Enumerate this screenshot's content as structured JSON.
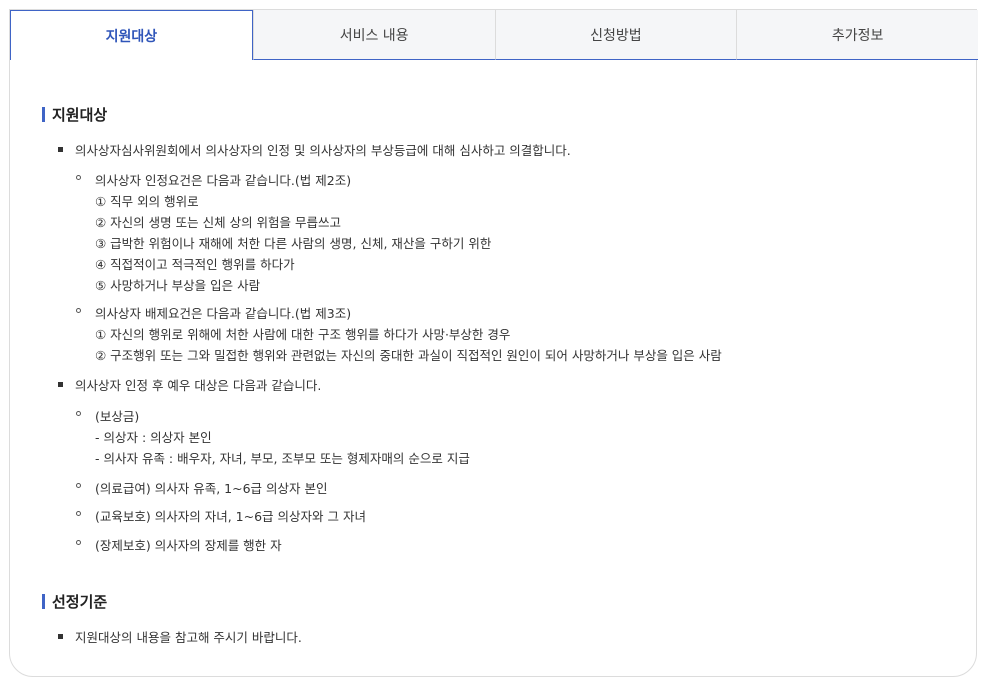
{
  "tabs": [
    {
      "label": "지원대상"
    },
    {
      "label": "서비스 내용"
    },
    {
      "label": "신청방법"
    },
    {
      "label": "추가정보"
    }
  ],
  "sections": {
    "target": {
      "title": "지원대상",
      "item1": "의사상자심사위원회에서 의사상자의 인정 및 의사상자의 부상등급에 대해 심사하고 의결합니다.",
      "sub1": {
        "lines": [
          "의사상자 인정요건은 다음과 같습니다.(법 제2조)",
          "① 직무 외의 행위로",
          "② 자신의 생명 또는 신체 상의 위험을 무릅쓰고",
          "③ 급박한 위험이나 재해에 처한 다른 사람의 생명, 신체, 재산을 구하기 위한",
          "④ 직접적이고 적극적인 행위를 하다가",
          "⑤ 사망하거나 부상을 입은 사람"
        ]
      },
      "sub2": {
        "lines": [
          "의사상자 배제요건은 다음과 같습니다.(법 제3조)",
          "① 자신의 행위로 위해에 처한 사람에 대한 구조 행위를 하다가 사망·부상한 경우",
          "② 구조행위 또는 그와 밀접한 행위와 관련없는 자신의 중대한 과실이 직접적인 원인이 되어 사망하거나 부상을 입은 사람"
        ]
      },
      "item2": "의사상자 인정 후 예우 대상은 다음과 같습니다.",
      "sub3": {
        "lines": [
          "(보상금)",
          "- 의상자 : 의상자 본인",
          "- 의사자 유족 : 배우자, 자녀, 부모, 조부모 또는 형제자매의 순으로 지급"
        ]
      },
      "sub4": "(의료급여) 의사자 유족, 1~6급 의상자 본인",
      "sub5": "(교육보호) 의사자의 자녀, 1~6급 의상자와 그 자녀",
      "sub6": "(장제보호) 의사자의 장제를 행한 자"
    },
    "criteria": {
      "title": "선정기준",
      "item1": "지원대상의 내용을 참고해 주시기 바랍니다."
    }
  },
  "colors": {
    "accent": "#3f64c6",
    "active_tab_text": "#2f55b9"
  }
}
